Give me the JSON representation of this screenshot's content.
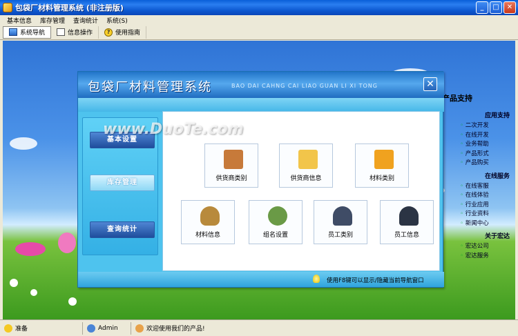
{
  "window": {
    "title": "包袋厂材料管理系统 (非注册版)"
  },
  "menu": {
    "items": [
      "基本信息",
      "库存管理",
      "查询统计",
      "系统(S)"
    ]
  },
  "toolbar": {
    "items": [
      {
        "label": "系统导航",
        "icon": "navigation-icon"
      },
      {
        "label": "信息操作",
        "icon": "document-icon"
      },
      {
        "label": "使用指南",
        "icon": "help-icon"
      }
    ]
  },
  "dialog": {
    "title": "包袋厂材料管理系统",
    "subtitle": "BAO DAI CAHNG CAI LIAO GUAN LI XI TONG",
    "close_label": "✕",
    "nav": [
      "基本设置",
      "库存管理",
      "查询统计"
    ],
    "tiles": [
      {
        "label": "供货商类别",
        "icon": "supplier-category-icon",
        "color": "#c77a3a"
      },
      {
        "label": "供货商信息",
        "icon": "folder-icon",
        "color": "#f2c54a"
      },
      {
        "label": "材料类别",
        "icon": "box-icon",
        "color": "#f0a21f"
      },
      {
        "label": "材料信息",
        "icon": "money-bag-icon",
        "color": "#b88a3c"
      },
      {
        "label": "组名设置",
        "icon": "group-icon",
        "color": "#6a9a46"
      },
      {
        "label": "员工类别",
        "icon": "employee-category-icon",
        "color": "#3f4c66"
      },
      {
        "label": "员工信息",
        "icon": "employee-icon",
        "color": "#2b3444"
      }
    ],
    "footer_text": "使用F8键可以显示/隐藏当前导航窗口"
  },
  "support": {
    "title": "产品支持",
    "sections": [
      {
        "heading": "应用支持",
        "links": [
          "二次开发",
          "在线开发",
          "业务帮助",
          "产品形式",
          "产品购买"
        ]
      },
      {
        "heading": "在线服务",
        "links": [
          "在线客服",
          "在线体验",
          "行业应用",
          "行业资料",
          "新闻中心"
        ]
      },
      {
        "heading": "关于宏达",
        "links": [
          "宏达公司",
          "宏达服务"
        ]
      }
    ]
  },
  "watermark": "www.DuoTe.com",
  "status": {
    "ready": "准备",
    "user": "Admin",
    "welcome": "欢迎使用我们的产品!"
  },
  "window_buttons": {
    "minimize": "_",
    "maximize": "□",
    "close": "✕"
  }
}
